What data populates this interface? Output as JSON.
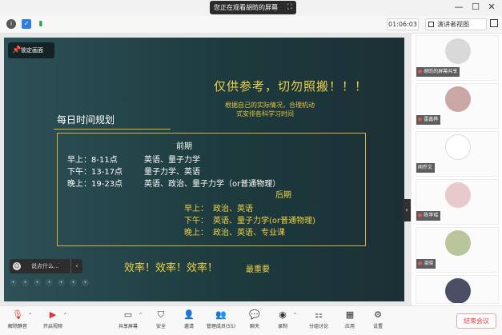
{
  "share_banner": {
    "text": "您正在观看胡昉的屏幕",
    "icon": "expand-icon"
  },
  "window_controls": {
    "minimize": "—",
    "maximize": "☐",
    "close": "✕"
  },
  "toolbar": {
    "timer": "01:06:03",
    "view_button": "演讲者视图",
    "info_icon": "info-icon",
    "shield_icon": "shield-icon",
    "signal_icon": "signal-icon",
    "maximize_icon": "fullscreen-icon"
  },
  "slide": {
    "pin_button": "锁定画面",
    "warning": "仅供参考，切勿照搬！！！",
    "note_line1": "根据自己的实际情况，合理机动",
    "note_line2": "式安排各科学习时间",
    "plan_title": "每日时间规划",
    "early_heading": "前期",
    "early_rows": [
      {
        "time": "早上：8-11点",
        "subjects": "英语、量子力学"
      },
      {
        "time": "下午：13-17点",
        "subjects": "量子力学、英语"
      },
      {
        "time": "晚上：19-23点",
        "subjects": "英语、政治、量子力学（or普通物理）"
      }
    ],
    "late_heading": "后期",
    "late_rows": [
      {
        "time": "早上：",
        "subjects": "政治、英语"
      },
      {
        "time": "下午：",
        "subjects": "英语、量子力学(or普通物理)"
      },
      {
        "time": "晚上：",
        "subjects": "政治、英语、专业课"
      }
    ],
    "slogan": "效率！效率！效率！",
    "slogan_tail": "最重要",
    "comment_placeholder": "说点什么...",
    "colors": {
      "gold": "#efd143",
      "bg": "#1d3b3e"
    }
  },
  "participants": [
    {
      "name": "胡昉的屏幕共享",
      "avatar_color": "#d9d9d9"
    },
    {
      "name": "雷鑫桦",
      "avatar_color": "#c9a7a2"
    },
    {
      "name": "闻乔文",
      "avatar_color": "#ffffff"
    },
    {
      "name": "陈李瑶",
      "avatar_color": "#e8c9cc"
    },
    {
      "name": "凌晓",
      "avatar_color": "#b9c59b"
    },
    {
      "name": "",
      "avatar_color": "#4a4f66"
    }
  ],
  "bottom": {
    "items": [
      {
        "label": "解除静音",
        "icon": "mic-off-icon"
      },
      {
        "label": "开启视频",
        "icon": "video-off-icon"
      },
      {
        "label": "共享屏幕",
        "icon": "share-screen-icon"
      },
      {
        "label": "安全",
        "icon": "security-icon"
      },
      {
        "label": "邀请",
        "icon": "invite-icon"
      },
      {
        "label": "管理成员(55)",
        "icon": "members-icon"
      },
      {
        "label": "聊天",
        "icon": "chat-icon"
      },
      {
        "label": "录制",
        "icon": "record-icon"
      },
      {
        "label": "分组讨论",
        "icon": "breakout-icon"
      },
      {
        "label": "应用",
        "icon": "apps-icon"
      },
      {
        "label": "设置",
        "icon": "settings-icon"
      }
    ],
    "end_button": "结束会议"
  }
}
